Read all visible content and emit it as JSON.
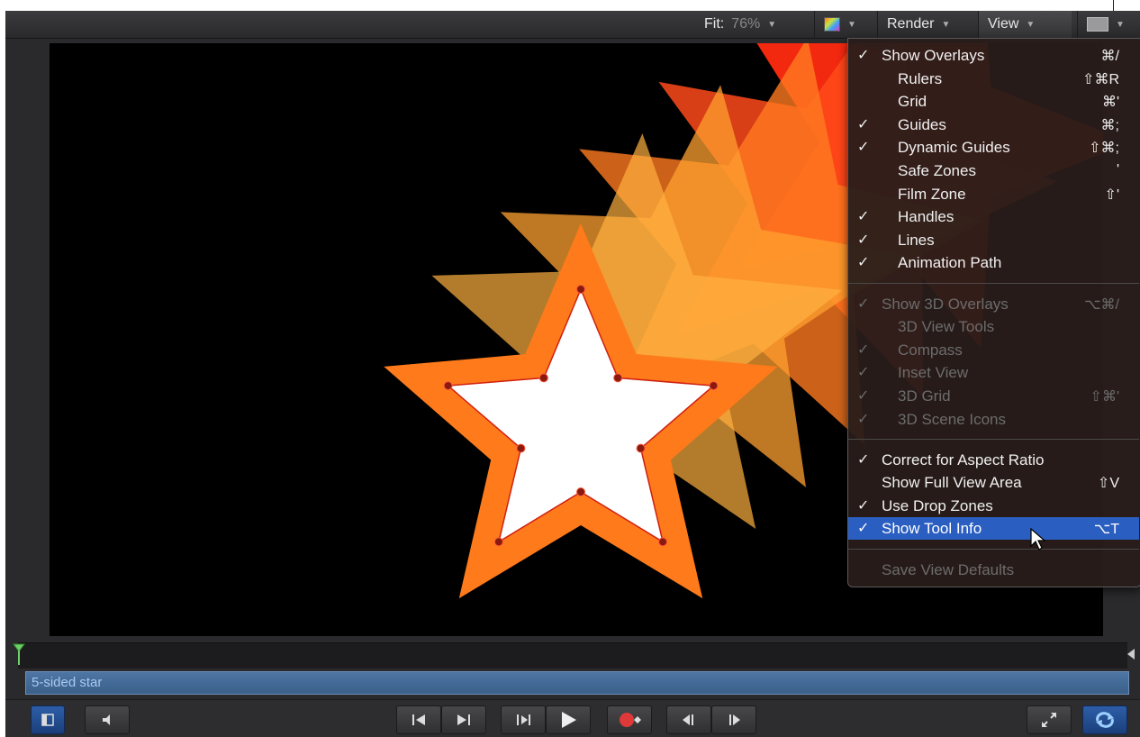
{
  "toolbar": {
    "fit_label": "Fit:",
    "fit_value": "76%",
    "render_label": "Render",
    "view_label": "View"
  },
  "view_menu": {
    "items": [
      {
        "label": "Show Overlays",
        "checked": true,
        "shortcut": "⌘/",
        "disabled": false,
        "indent": false
      },
      {
        "label": "Rulers",
        "checked": false,
        "shortcut": "⇧⌘R",
        "disabled": false,
        "indent": true
      },
      {
        "label": "Grid",
        "checked": false,
        "shortcut": "⌘'",
        "disabled": false,
        "indent": true
      },
      {
        "label": "Guides",
        "checked": true,
        "shortcut": "⌘;",
        "disabled": false,
        "indent": true
      },
      {
        "label": "Dynamic Guides",
        "checked": true,
        "shortcut": "⇧⌘;",
        "disabled": false,
        "indent": true
      },
      {
        "label": "Safe Zones",
        "checked": false,
        "shortcut": "'",
        "disabled": false,
        "indent": true
      },
      {
        "label": "Film Zone",
        "checked": false,
        "shortcut": "⇧'",
        "disabled": false,
        "indent": true
      },
      {
        "label": "Handles",
        "checked": true,
        "shortcut": "",
        "disabled": false,
        "indent": true
      },
      {
        "label": "Lines",
        "checked": true,
        "shortcut": "",
        "disabled": false,
        "indent": true
      },
      {
        "label": "Animation Path",
        "checked": true,
        "shortcut": "",
        "disabled": false,
        "indent": true
      },
      {
        "label": "Show 3D Overlays",
        "checked": true,
        "shortcut": "⌥⌘/",
        "disabled": true,
        "indent": false
      },
      {
        "label": "3D View Tools",
        "checked": false,
        "shortcut": "",
        "disabled": true,
        "indent": true
      },
      {
        "label": "Compass",
        "checked": true,
        "shortcut": "",
        "disabled": true,
        "indent": true
      },
      {
        "label": "Inset View",
        "checked": true,
        "shortcut": "",
        "disabled": true,
        "indent": true
      },
      {
        "label": "3D Grid",
        "checked": true,
        "shortcut": "⇧⌘'",
        "disabled": true,
        "indent": true
      },
      {
        "label": "3D Scene Icons",
        "checked": true,
        "shortcut": "",
        "disabled": true,
        "indent": true
      },
      {
        "label": "Correct for Aspect Ratio",
        "checked": true,
        "shortcut": "",
        "disabled": false,
        "indent": false
      },
      {
        "label": "Show Full View Area",
        "checked": false,
        "shortcut": "⇧V",
        "disabled": false,
        "indent": false
      },
      {
        "label": "Use Drop Zones",
        "checked": true,
        "shortcut": "",
        "disabled": false,
        "indent": false
      },
      {
        "label": "Show Tool Info",
        "checked": true,
        "shortcut": "⌥T",
        "disabled": false,
        "indent": false,
        "highlighted": true
      },
      {
        "label": "Save View Defaults",
        "checked": false,
        "shortcut": "",
        "disabled": true,
        "indent": false
      }
    ]
  },
  "timeline": {
    "track_label": "5-sided star"
  },
  "icons": {
    "canvas_mode": "canvas-mode-icon",
    "audio": "speaker-icon",
    "go_to_start": "go-to-start-icon",
    "go_to_end": "go-to-end-icon",
    "play_from_start": "play-from-start-icon",
    "play": "play-icon",
    "record": "record-icon",
    "prev_frame": "previous-frame-icon",
    "next_frame": "next-frame-icon",
    "fullscreen": "fullscreen-icon",
    "loop": "loop-icon"
  },
  "colors": {
    "menu_highlight": "#2a5ec0",
    "track": "#4a6f9c",
    "star_fill": "#ff7a1a",
    "star_inner": "#ffffff",
    "handle": "#cc2200"
  }
}
